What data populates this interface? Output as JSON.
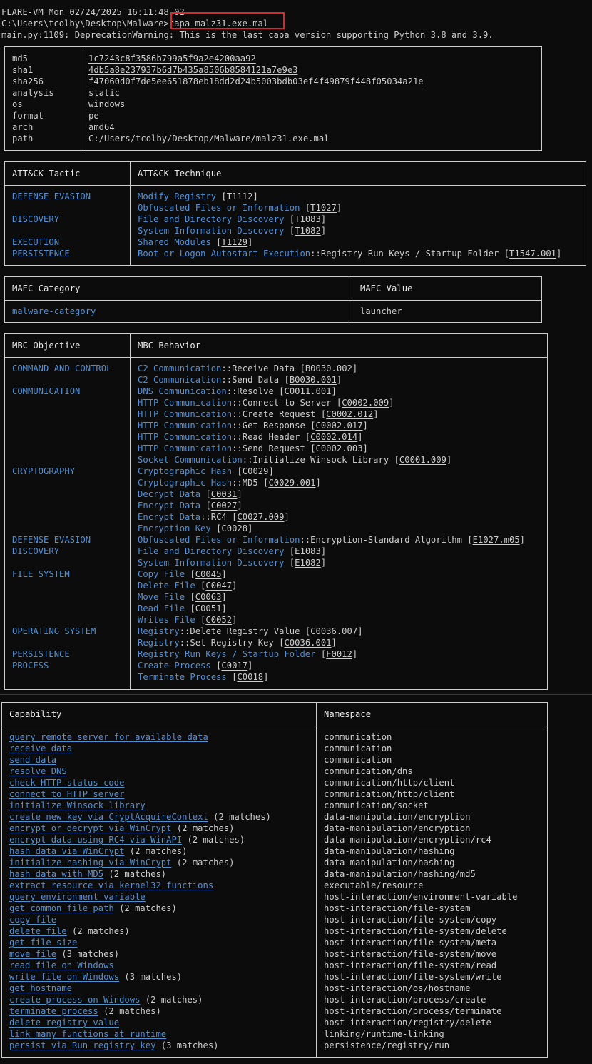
{
  "terminal": {
    "line1": "FLARE-VM Mon 02/24/2025 16:11:48.02",
    "prompt": "C:\\Users\\tcolby\\Desktop\\Malware>",
    "command": "capa malz31.exe.mal",
    "warning": "main.py:1109: DeprecationWarning: This is the last capa version supporting Python 3.8 and 3.9."
  },
  "meta": [
    {
      "k": "md5",
      "v": "1c7243c8f3586b799a5f9a2e4200aa92",
      "ul": true
    },
    {
      "k": "sha1",
      "v": "4db5a8e237937b6d7b435a8506b8584121a7e9e3",
      "ul": true
    },
    {
      "k": "sha256",
      "v": "f47060d0f7de5ee651878eb18dd2d24b5003bdb03ef4f49879f448f05034a21e",
      "ul": true
    },
    {
      "k": "analysis",
      "v": "static",
      "ul": false
    },
    {
      "k": "os",
      "v": "windows",
      "ul": false
    },
    {
      "k": "format",
      "v": "pe",
      "ul": false
    },
    {
      "k": "arch",
      "v": "amd64",
      "ul": false
    },
    {
      "k": "path",
      "v": "C:/Users/tcolby/Desktop/Malware/malz31.exe.mal",
      "ul": false
    }
  ],
  "attack": {
    "h1": "ATT&CK Tactic",
    "h2": "ATT&CK Technique",
    "rows": [
      {
        "a": "DEFENSE EVASION",
        "b": "Modify Registry",
        "c": "",
        "id": "T1112"
      },
      {
        "a": "",
        "b": "Obfuscated Files or Information",
        "c": "",
        "id": "T1027"
      },
      {
        "a": "DISCOVERY",
        "b": "File and Directory Discovery",
        "c": "",
        "id": "T1083"
      },
      {
        "a": "",
        "b": "System Information Discovery",
        "c": "",
        "id": "T1082"
      },
      {
        "a": "EXECUTION",
        "b": "Shared Modules",
        "c": "",
        "id": "T1129"
      },
      {
        "a": "PERSISTENCE",
        "b": "Boot or Logon Autostart Execution",
        "c": "::Registry Run Keys / Startup Folder",
        "id": "T1547.001"
      }
    ]
  },
  "maec": {
    "h1": "MAEC Category",
    "h2": "MAEC Value",
    "category": "malware-category",
    "value": "launcher"
  },
  "mbc": {
    "h1": "MBC Objective",
    "h2": "MBC Behavior",
    "rows": [
      {
        "a": "COMMAND AND CONTROL",
        "b": "C2 Communication",
        "c": "::Receive Data",
        "id": "B0030.002"
      },
      {
        "a": "",
        "b": "C2 Communication",
        "c": "::Send Data",
        "id": "B0030.001"
      },
      {
        "a": "COMMUNICATION",
        "b": "DNS Communication",
        "c": "::Resolve",
        "id": "C0011.001"
      },
      {
        "a": "",
        "b": "HTTP Communication",
        "c": "::Connect to Server",
        "id": "C0002.009"
      },
      {
        "a": "",
        "b": "HTTP Communication",
        "c": "::Create Request",
        "id": "C0002.012"
      },
      {
        "a": "",
        "b": "HTTP Communication",
        "c": "::Get Response",
        "id": "C0002.017"
      },
      {
        "a": "",
        "b": "HTTP Communication",
        "c": "::Read Header",
        "id": "C0002.014"
      },
      {
        "a": "",
        "b": "HTTP Communication",
        "c": "::Send Request",
        "id": "C0002.003"
      },
      {
        "a": "",
        "b": "Socket Communication",
        "c": "::Initialize Winsock Library",
        "id": "C0001.009"
      },
      {
        "a": "CRYPTOGRAPHY",
        "b": "Cryptographic Hash",
        "c": "",
        "id": "C0029"
      },
      {
        "a": "",
        "b": "Cryptographic Hash",
        "c": "::MD5",
        "id": "C0029.001"
      },
      {
        "a": "",
        "b": "Decrypt Data",
        "c": "",
        "id": "C0031"
      },
      {
        "a": "",
        "b": "Encrypt Data",
        "c": "",
        "id": "C0027"
      },
      {
        "a": "",
        "b": "Encrypt Data",
        "c": "::RC4",
        "id": "C0027.009"
      },
      {
        "a": "",
        "b": "Encryption Key",
        "c": "",
        "id": "C0028"
      },
      {
        "a": "DEFENSE EVASION",
        "b": "Obfuscated Files or Information",
        "c": "::Encryption-Standard Algorithm",
        "id": "E1027.m05"
      },
      {
        "a": "DISCOVERY",
        "b": "File and Directory Discovery",
        "c": "",
        "id": "E1083"
      },
      {
        "a": "",
        "b": "System Information Discovery",
        "c": "",
        "id": "E1082"
      },
      {
        "a": "FILE SYSTEM",
        "b": "Copy File",
        "c": "",
        "id": "C0045"
      },
      {
        "a": "",
        "b": "Delete File",
        "c": "",
        "id": "C0047"
      },
      {
        "a": "",
        "b": "Move File",
        "c": "",
        "id": "C0063"
      },
      {
        "a": "",
        "b": "Read File",
        "c": "",
        "id": "C0051"
      },
      {
        "a": "",
        "b": "Writes File",
        "c": "",
        "id": "C0052"
      },
      {
        "a": "OPERATING SYSTEM",
        "b": "Registry",
        "c": "::Delete Registry Value",
        "id": "C0036.007"
      },
      {
        "a": "",
        "b": "Registry",
        "c": "::Set Registry Key",
        "id": "C0036.001"
      },
      {
        "a": "PERSISTENCE",
        "b": "Registry Run Keys / Startup Folder",
        "c": "",
        "id": "F0012"
      },
      {
        "a": "PROCESS",
        "b": "Create Process",
        "c": "",
        "id": "C0017"
      },
      {
        "a": "",
        "b": "Terminate Process",
        "c": "",
        "id": "C0018"
      }
    ]
  },
  "caps": {
    "h1": "Capability",
    "h2": "Namespace",
    "rows": [
      {
        "name": "query remote server for available data",
        "extra": "",
        "ns": "communication"
      },
      {
        "name": "receive data",
        "extra": "",
        "ns": "communication"
      },
      {
        "name": "send data",
        "extra": "",
        "ns": "communication"
      },
      {
        "name": "resolve DNS",
        "extra": "",
        "ns": "communication/dns"
      },
      {
        "name": "check HTTP status code",
        "extra": "",
        "ns": "communication/http/client"
      },
      {
        "name": "connect to HTTP server",
        "extra": "",
        "ns": "communication/http/client"
      },
      {
        "name": "initialize Winsock library",
        "extra": "",
        "ns": "communication/socket"
      },
      {
        "name": "create new key via CryptAcquireContext",
        "extra": " (2 matches)",
        "ns": "data-manipulation/encryption"
      },
      {
        "name": "encrypt or decrypt via WinCrypt",
        "extra": " (2 matches)",
        "ns": "data-manipulation/encryption"
      },
      {
        "name": "encrypt data using RC4 via WinAPI",
        "extra": " (2 matches)",
        "ns": "data-manipulation/encryption/rc4"
      },
      {
        "name": "hash data via WinCrypt",
        "extra": " (2 matches)",
        "ns": "data-manipulation/hashing"
      },
      {
        "name": "initialize hashing via WinCrypt",
        "extra": " (2 matches)",
        "ns": "data-manipulation/hashing"
      },
      {
        "name": "hash data with MD5",
        "extra": " (2 matches)",
        "ns": "data-manipulation/hashing/md5"
      },
      {
        "name": "extract resource via kernel32 functions",
        "extra": "",
        "ns": "executable/resource"
      },
      {
        "name": "query environment variable",
        "extra": "",
        "ns": "host-interaction/environment-variable"
      },
      {
        "name": "get common file path",
        "extra": " (2 matches)",
        "ns": "host-interaction/file-system"
      },
      {
        "name": "copy file",
        "extra": "",
        "ns": "host-interaction/file-system/copy"
      },
      {
        "name": "delete file",
        "extra": " (2 matches)",
        "ns": "host-interaction/file-system/delete"
      },
      {
        "name": "get file size",
        "extra": "",
        "ns": "host-interaction/file-system/meta"
      },
      {
        "name": "move file",
        "extra": " (3 matches)",
        "ns": "host-interaction/file-system/move"
      },
      {
        "name": "read file on Windows",
        "extra": "",
        "ns": "host-interaction/file-system/read"
      },
      {
        "name": "write file on Windows",
        "extra": " (3 matches)",
        "ns": "host-interaction/file-system/write"
      },
      {
        "name": "get hostname",
        "extra": "",
        "ns": "host-interaction/os/hostname"
      },
      {
        "name": "create process on Windows",
        "extra": " (2 matches)",
        "ns": "host-interaction/process/create"
      },
      {
        "name": "terminate process",
        "extra": " (2 matches)",
        "ns": "host-interaction/process/terminate"
      },
      {
        "name": "delete registry value",
        "extra": "",
        "ns": "host-interaction/registry/delete"
      },
      {
        "name": "link many functions at runtime",
        "extra": "",
        "ns": "linking/runtime-linking"
      },
      {
        "name": "persist via Run registry key",
        "extra": " (3 matches)",
        "ns": "persistence/registry/run"
      }
    ]
  }
}
